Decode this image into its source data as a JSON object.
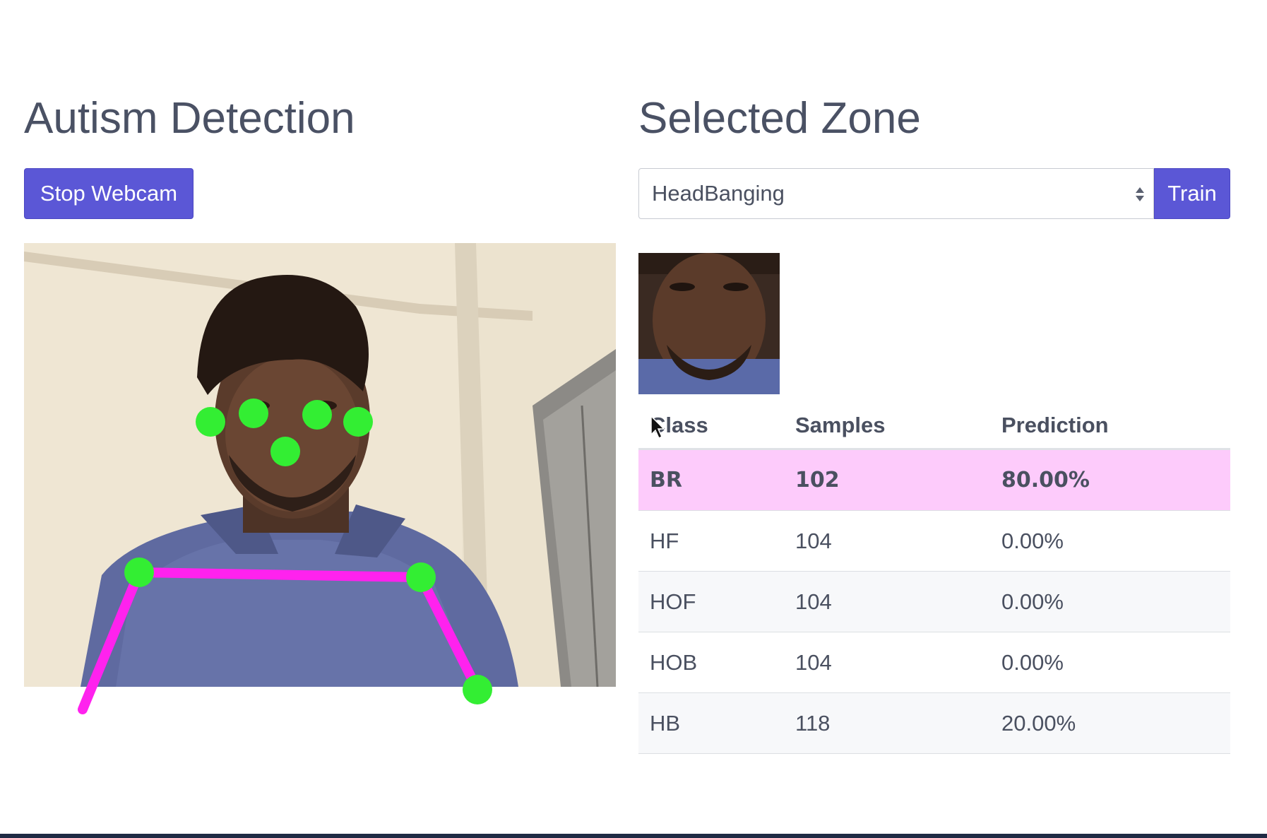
{
  "left": {
    "title": "Autism Detection",
    "stop_button_label": "Stop Webcam"
  },
  "right": {
    "title": "Selected Zone",
    "zone_select": {
      "selected": "HeadBanging"
    },
    "train_button_label": "Train"
  },
  "table": {
    "headers": [
      "Class",
      "Samples",
      "Prediction"
    ],
    "rows": [
      {
        "class": "BR",
        "samples": "102",
        "prediction": "80.00%",
        "highlight": true
      },
      {
        "class": "HF",
        "samples": "104",
        "prediction": "0.00%"
      },
      {
        "class": "HOF",
        "samples": "104",
        "prediction": "0.00%"
      },
      {
        "class": "HOB",
        "samples": "104",
        "prediction": "0.00%"
      },
      {
        "class": "HB",
        "samples": "118",
        "prediction": "20.00%"
      }
    ]
  },
  "colors": {
    "accent": "#5b57d6",
    "highlight_row": "#fdcbfb",
    "keypoint": "#33ee33",
    "skeleton": "#ff22ee"
  }
}
